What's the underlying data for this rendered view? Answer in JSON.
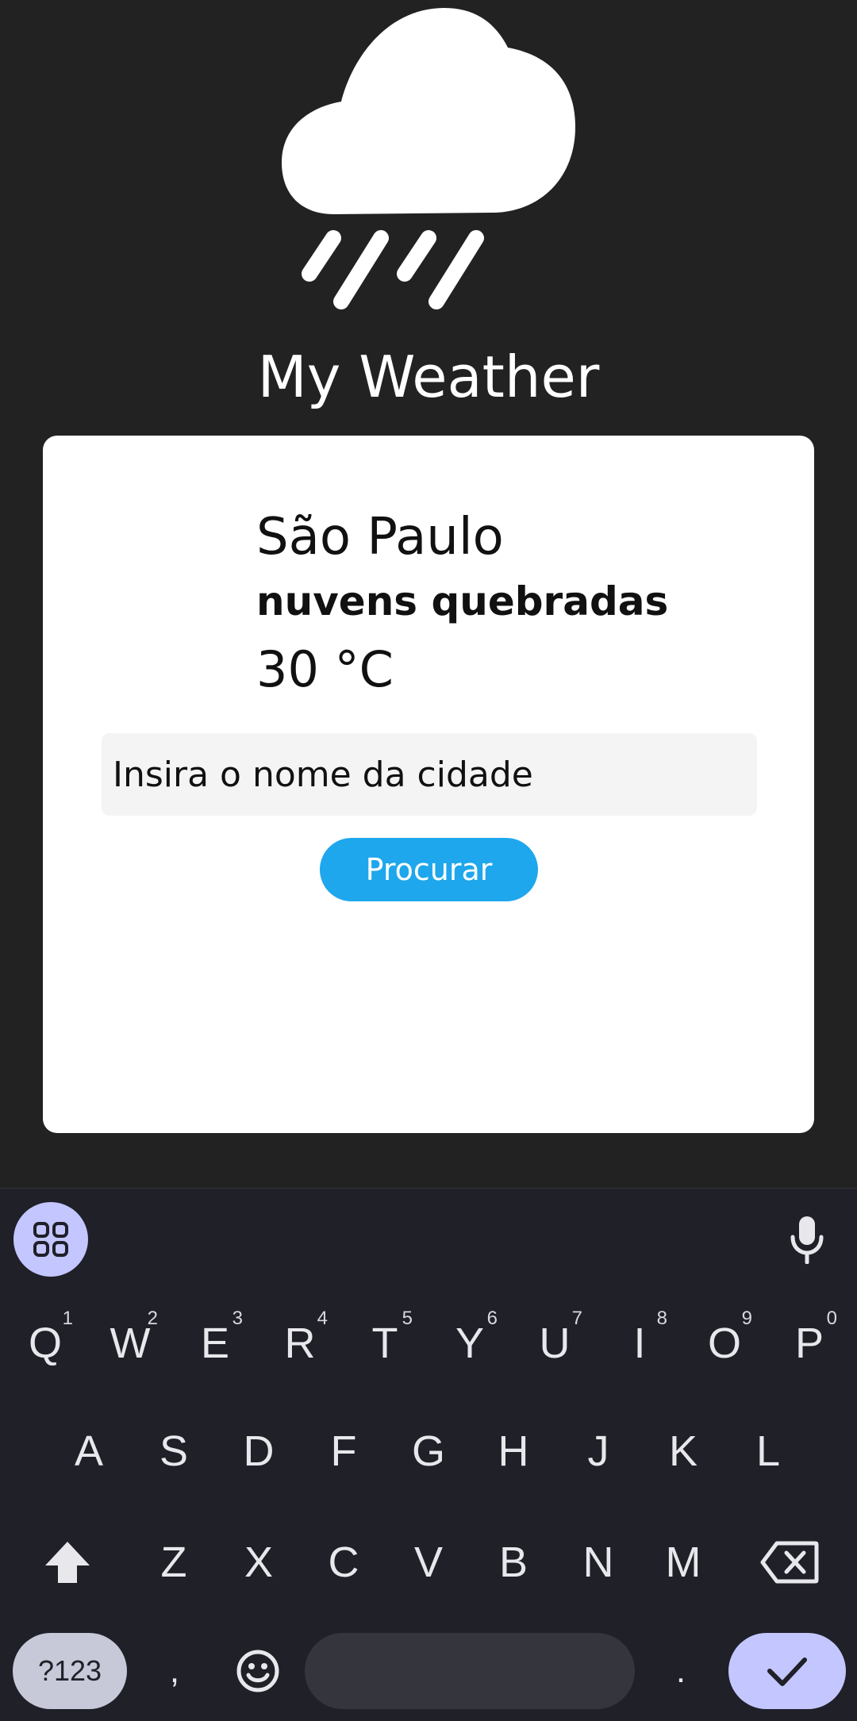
{
  "app": {
    "title": "My Weather",
    "logo_icon": "cloud-rain-icon"
  },
  "weather": {
    "city": "São Paulo",
    "description": "nuvens quebradas",
    "temperature": "30 °C"
  },
  "search": {
    "placeholder": "Insira o nome da cidade",
    "button_label": "Procurar"
  },
  "keyboard": {
    "row1": [
      {
        "label": "Q",
        "hint": "1"
      },
      {
        "label": "W",
        "hint": "2"
      },
      {
        "label": "E",
        "hint": "3"
      },
      {
        "label": "R",
        "hint": "4"
      },
      {
        "label": "T",
        "hint": "5"
      },
      {
        "label": "Y",
        "hint": "6"
      },
      {
        "label": "U",
        "hint": "7"
      },
      {
        "label": "I",
        "hint": "8"
      },
      {
        "label": "O",
        "hint": "9"
      },
      {
        "label": "P",
        "hint": "0"
      }
    ],
    "row2": [
      "A",
      "S",
      "D",
      "F",
      "G",
      "H",
      "J",
      "K",
      "L"
    ],
    "row3": [
      "Z",
      "X",
      "C",
      "V",
      "B",
      "N",
      "M"
    ],
    "symbols_label": "?123",
    "comma_label": ",",
    "period_label": ".",
    "icons": {
      "apps": "grid-icon",
      "mic": "microphone-icon",
      "shift": "shift-arrow-icon",
      "backspace": "backspace-icon",
      "emoji": "emoji-icon",
      "enter": "checkmark-icon"
    },
    "colors": {
      "background": "#1f2028",
      "accent": "#c4c6ff"
    }
  },
  "colors": {
    "app_background": "#222222",
    "card_background": "#ffffff",
    "button_blue": "#1ea7ec",
    "input_background": "#f4f4f4"
  }
}
